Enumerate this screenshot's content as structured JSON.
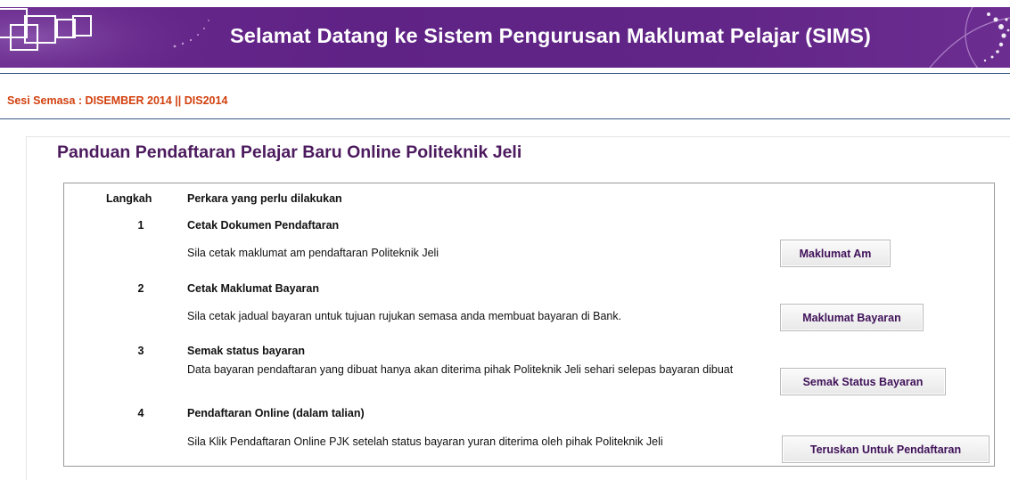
{
  "header": {
    "title": "Selamat Datang ke Sistem Pengurusan Maklumat Pelajar (SIMS)"
  },
  "session": {
    "text": "Sesi Semasa : DISEMBER 2014 || DIS2014"
  },
  "page": {
    "title": "Panduan Pendaftaran Pelajar Baru Online Politeknik Jeli"
  },
  "table": {
    "headers": [
      "Langkah",
      "Perkara yang perlu dilakukan"
    ],
    "steps": [
      {
        "number": "1",
        "title": "Cetak Dokumen Pendaftaran",
        "description": "Sila cetak maklumat am pendaftaran Politeknik Jeli",
        "button": "Maklumat Am"
      },
      {
        "number": "2",
        "title": "Cetak Maklumat Bayaran",
        "description": "Sila cetak jadual bayaran untuk tujuan rujukan semasa anda membuat bayaran di Bank.",
        "button": "Maklumat Bayaran"
      },
      {
        "number": "3",
        "title": "Semak status bayaran",
        "description": "Data bayaran pendaftaran yang dibuat hanya akan diterima pihak Politeknik Jeli sehari selepas bayaran dibuat",
        "button": "Semak Status Bayaran"
      },
      {
        "number": "4",
        "title": "Pendaftaran Online (dalam talian)",
        "description": "Sila Klik Pendaftaran Online PJK setelah status bayaran yuran diterima oleh pihak Politeknik Jeli",
        "button": "Teruskan Untuk Pendaftaran"
      }
    ]
  },
  "colors": {
    "banner": "#5f2285",
    "session_text": "#d2410f",
    "page_title": "#4c1a5e",
    "button_text": "#3f1159"
  }
}
